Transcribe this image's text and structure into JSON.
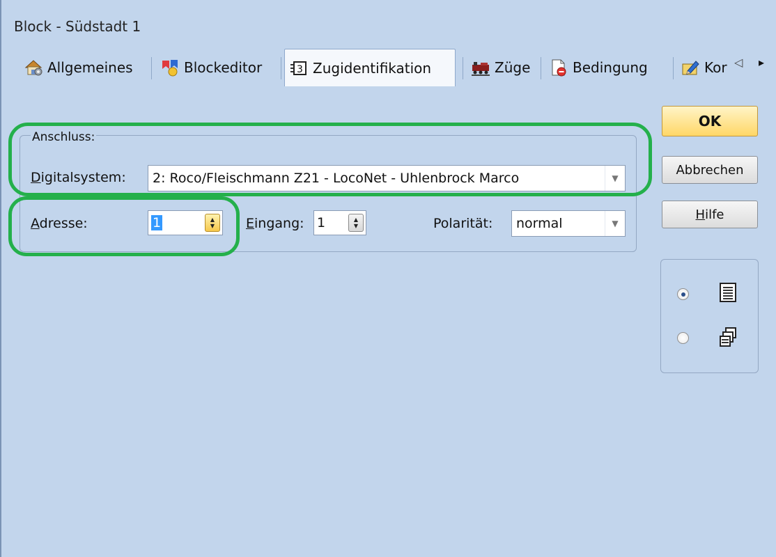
{
  "window": {
    "title": "Block - Südstadt 1"
  },
  "tabs": [
    {
      "label": "Allgemeines",
      "icon": "house-gear-icon",
      "active": false
    },
    {
      "label": "Blockeditor",
      "icon": "blockeditor-icon",
      "active": false
    },
    {
      "label": "Zugidentifikation",
      "icon": "train-id-icon",
      "active": true
    },
    {
      "label": "Züge",
      "icon": "trains-icon",
      "active": false
    },
    {
      "label": "Bedingung",
      "icon": "condition-document-icon",
      "active": false
    },
    {
      "label": "Kor",
      "icon": "pencil-edit-icon",
      "active": false
    }
  ],
  "tab_nav": {
    "prev": "◁",
    "next": "▸"
  },
  "anschluss": {
    "legend": "Anschluss:",
    "digitalsystem": {
      "label_mnemonic": "D",
      "label_rest": "igitalsystem:",
      "value": "2: Roco/Fleischmann Z21 - LocoNet - Uhlenbrock Marco"
    },
    "adresse": {
      "label_mnemonic": "A",
      "label_rest": "dresse:",
      "value": "1"
    },
    "eingang": {
      "label_mnemonic": "E",
      "label_rest": "ingang:",
      "value": "1"
    },
    "polaritaet": {
      "label": "Polarität:",
      "value": "normal"
    }
  },
  "buttons": {
    "ok": "OK",
    "cancel": "Abbrechen",
    "help_mnemonic": "H",
    "help_rest": "ilfe"
  },
  "view_options": [
    {
      "icon": "list-view-icon",
      "selected": true
    },
    {
      "icon": "multi-window-icon",
      "selected": false
    }
  ],
  "colors": {
    "background": "#c2d5ec",
    "highlight": "#24b04b",
    "ok_button": "#ffd767",
    "selection": "#3399ff"
  }
}
